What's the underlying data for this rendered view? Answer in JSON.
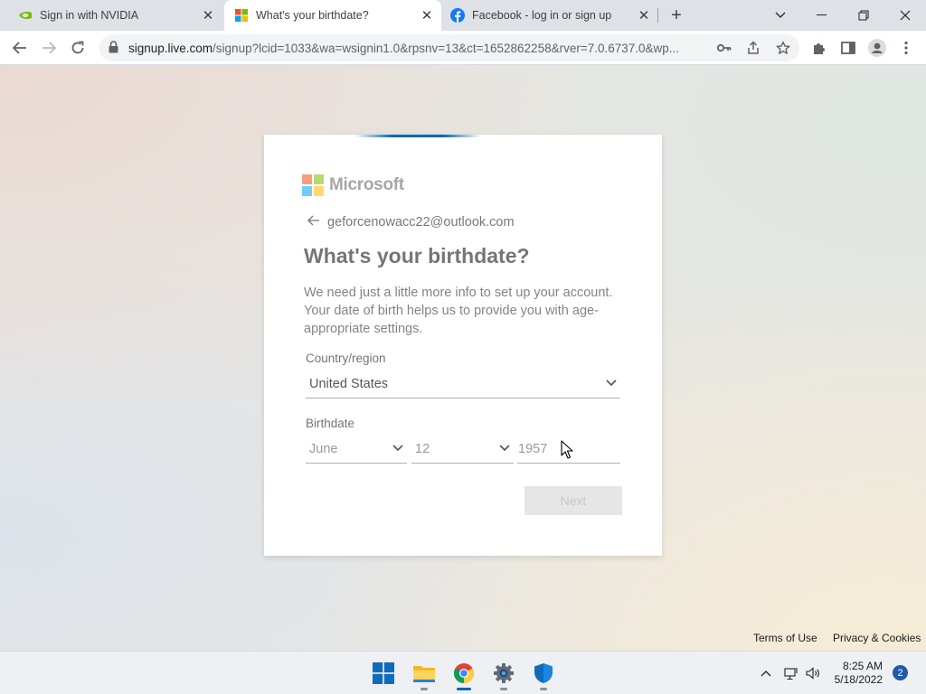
{
  "browser": {
    "tabs": [
      {
        "title": "Sign in with NVIDIA",
        "icon": "nvidia-icon",
        "active": false
      },
      {
        "title": "What's your birthdate?",
        "icon": "microsoft-icon",
        "active": true
      },
      {
        "title": "Facebook - log in or sign up",
        "icon": "facebook-icon",
        "active": false
      }
    ],
    "new_tab": "+",
    "url_host": "signup.live.com",
    "url_rest": "/signup?lcid=1033&wa=wsignin1.0&rpsnv=13&ct=1652862258&rver=7.0.6737.0&wp..."
  },
  "card": {
    "brand": "Microsoft",
    "email": "geforcenowacc22@outlook.com",
    "heading": "What's your birthdate?",
    "description": "We need just a little more info to set up your account. Your date of birth helps us to provide you with age-appropriate settings.",
    "country_label": "Country/region",
    "country_value": "United States",
    "birthdate_label": "Birthdate",
    "month_value": "June",
    "day_value": "12",
    "year_value": "1957",
    "next_label": "Next"
  },
  "footer": {
    "terms": "Terms of Use",
    "privacy": "Privacy & Cookies"
  },
  "taskbar": {
    "apps": [
      "start-icon",
      "file-explorer-icon",
      "chrome-icon",
      "settings-icon",
      "defender-icon"
    ],
    "time": "8:25 AM",
    "date": "5/18/2022",
    "notification_count": "2"
  },
  "colors": {
    "accent": "#0067b8",
    "ms_red": "#f25022",
    "ms_green": "#7fba00",
    "ms_blue": "#00a4ef",
    "ms_yellow": "#ffb900"
  }
}
